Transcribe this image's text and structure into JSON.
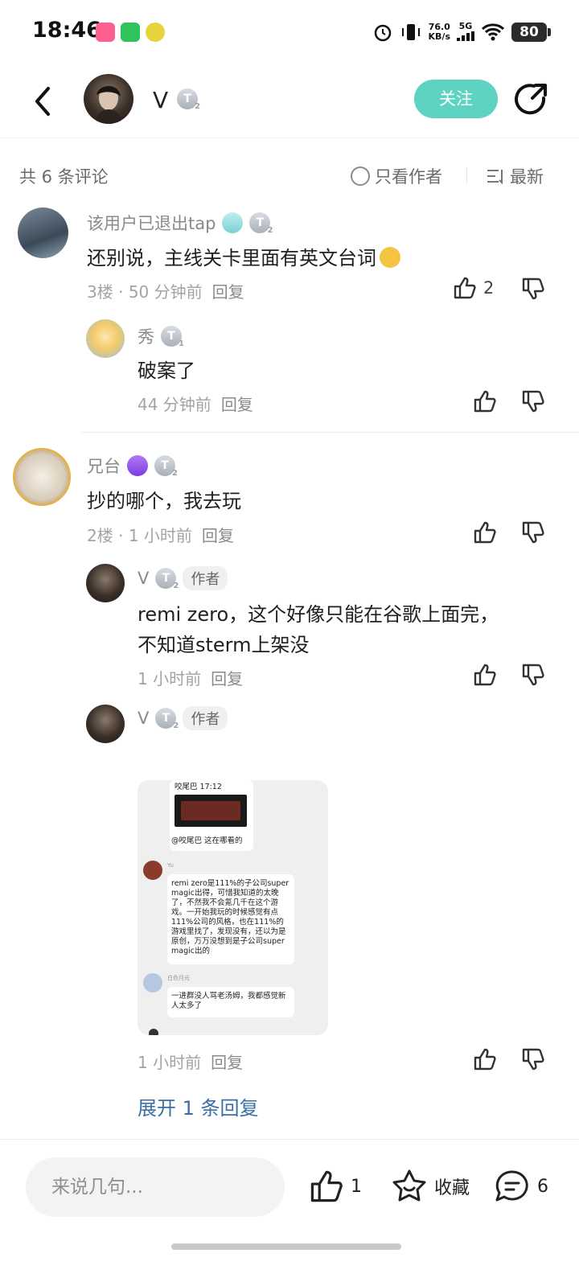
{
  "status_bar": {
    "time": "18:46",
    "net_speed_value": "76.0",
    "net_speed_unit": "KB/s",
    "signal": "5G",
    "battery": "80"
  },
  "header": {
    "username": "V",
    "user_level": "2",
    "follow_label": "关注"
  },
  "comments_bar": {
    "count_label": "共 6 条评论",
    "only_author_label": "只看作者",
    "sort_label": "最新"
  },
  "comments": [
    {
      "user": "该用户已退出tap",
      "level": "2",
      "text": "还别说，主线关卡里面有英文台词",
      "floor": "3楼",
      "time": "50 分钟前",
      "reply_label": "回复",
      "likes": "2",
      "replies": [
        {
          "user": "秀",
          "level": "1",
          "text": "破案了",
          "time": "44 分钟前",
          "reply_label": "回复"
        }
      ]
    },
    {
      "user": "兄台",
      "level": "2",
      "text": "抄的哪个，我去玩",
      "floor": "2楼",
      "time": "1 小时前",
      "reply_label": "回复",
      "replies": [
        {
          "user": "V",
          "level": "2",
          "tag": "作者",
          "text_line1": "remi zero，这个好像只能在谷歌上面完，",
          "text_line2": "不知道sterm上架没",
          "time": "1 小时前",
          "reply_label": "回复"
        },
        {
          "user": "V",
          "level": "2",
          "tag": "作者",
          "time": "1 小时前",
          "reply_label": "回复"
        }
      ],
      "expand_label": "展开 1 条回复"
    }
  ],
  "screenshot": {
    "top_card_title": "咬尾巴 17:12",
    "top_card_caption": "@咬尾巴 这在哪看的",
    "msg1_name": "Yu",
    "msg1_text": "remi zero是111%的子公司super magic出得，可惜我知道的太晚了，不然我不会氪几千在这个游戏。一开始我玩的时候感觉有点111%公司的风格，也在111%的游戏里找了，发现没有，还以为是原创，万万没想到是子公司super magic出的",
    "msg2_name": "白色月光",
    "msg2_text": "一进群没人骂老汤姆，我都感觉新人太多了"
  },
  "bottom_bar": {
    "input_placeholder": "来说几句...",
    "like_count": "1",
    "favorite_label": "收藏",
    "comment_count": "6"
  },
  "colors": {
    "accent": "#5fd3c1",
    "link": "#3a6ea5"
  }
}
